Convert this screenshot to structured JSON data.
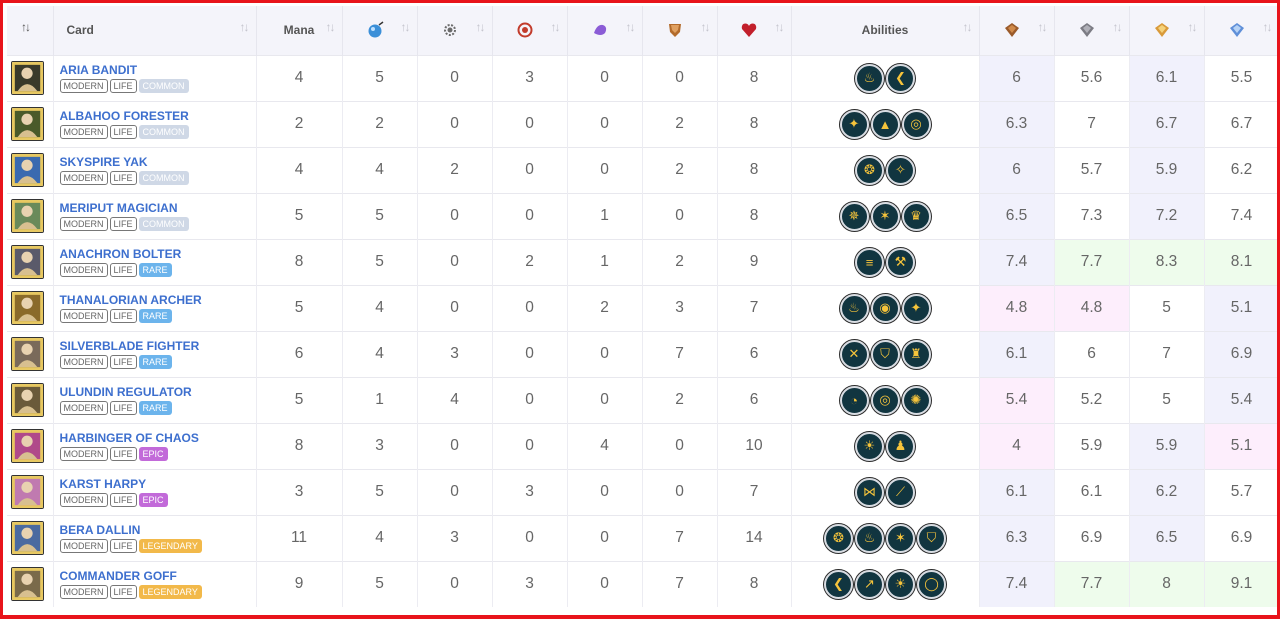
{
  "header": {
    "card_label": "Card",
    "mana_label": "Mana",
    "abilities_label": "Abilities",
    "sort_glyph": "↑↓",
    "stat_icons": [
      {
        "name": "ranged-attack-icon",
        "color": "#3b8fd8"
      },
      {
        "name": "magic-attack-icon",
        "color": "#6b6b6b"
      },
      {
        "name": "melee-attack-icon",
        "color": "#c23b2b"
      },
      {
        "name": "speed-icon",
        "color": "#8b5cd6"
      },
      {
        "name": "armor-icon",
        "color": "#b36b2b"
      },
      {
        "name": "health-icon",
        "color": "#c21f2b"
      }
    ],
    "level_icons": [
      {
        "name": "bronze-league-icon",
        "color": "#9a5a2a"
      },
      {
        "name": "silver-league-icon",
        "color": "#7c7c84"
      },
      {
        "name": "gold-league-icon",
        "color": "#d99a3a"
      },
      {
        "name": "diamond-league-icon",
        "color": "#5f8fd8"
      }
    ]
  },
  "colors": {
    "common": "#cfd8e6",
    "rare": "#6cb4ec",
    "epic": "#c26ad9",
    "legendary": "#f2b94a",
    "link": "#3d6fce",
    "frame": "#e8141b"
  },
  "rows": [
    {
      "name": "ARIA BANDIT",
      "edition": "MODERN",
      "element": "LIFE",
      "rarity": "COMMON",
      "rarity_key": "common",
      "thumb": "#3a3a2a",
      "mana": "4",
      "stats": [
        "5",
        "0",
        "3",
        "0",
        "0",
        "8"
      ],
      "abilities": [
        {
          "icon": "scavenger-icon",
          "glyph": "♨"
        },
        {
          "icon": "sneak-icon",
          "glyph": "❮"
        }
      ],
      "levels": [
        "6",
        "5.6",
        "6.1",
        "5.5"
      ],
      "level_bg": [
        "lav",
        "white",
        "lav",
        "white"
      ]
    },
    {
      "name": "ALBAHOO FORESTER",
      "edition": "MODERN",
      "element": "LIFE",
      "rarity": "COMMON",
      "rarity_key": "common",
      "thumb": "#4a5a2a",
      "mana": "2",
      "stats": [
        "2",
        "0",
        "0",
        "0",
        "2",
        "8"
      ],
      "abilities": [
        {
          "icon": "martyr-icon",
          "glyph": "✦"
        },
        {
          "icon": "divine-shield-icon",
          "glyph": "▲"
        },
        {
          "icon": "target-icon",
          "glyph": "◎"
        }
      ],
      "levels": [
        "6.3",
        "7",
        "6.7",
        "6.7"
      ],
      "level_bg": [
        "lav",
        "white",
        "lav",
        "white"
      ]
    },
    {
      "name": "SKYSPIRE YAK",
      "edition": "MODERN",
      "element": "LIFE",
      "rarity": "COMMON",
      "rarity_key": "common",
      "thumb": "#3a6ab0",
      "mana": "4",
      "stats": [
        "4",
        "2",
        "0",
        "0",
        "2",
        "8"
      ],
      "abilities": [
        {
          "icon": "retaliate-icon",
          "glyph": "❂"
        },
        {
          "icon": "blast-icon",
          "glyph": "✧"
        }
      ],
      "levels": [
        "6",
        "5.7",
        "5.9",
        "6.2"
      ],
      "level_bg": [
        "lav",
        "white",
        "lav",
        "white"
      ]
    },
    {
      "name": "MERIPUT MAGICIAN",
      "edition": "MODERN",
      "element": "LIFE",
      "rarity": "COMMON",
      "rarity_key": "common",
      "thumb": "#6a8a5a",
      "mana": "5",
      "stats": [
        "5",
        "0",
        "0",
        "1",
        "0",
        "8"
      ],
      "abilities": [
        {
          "icon": "flash-icon",
          "glyph": "✵"
        },
        {
          "icon": "strength-icon",
          "glyph": "✶"
        },
        {
          "icon": "crown-icon",
          "glyph": "♛"
        }
      ],
      "levels": [
        "6.5",
        "7.3",
        "7.2",
        "7.4"
      ],
      "level_bg": [
        "lav",
        "white",
        "lav",
        "white"
      ]
    },
    {
      "name": "ANACHRON BOLTER",
      "edition": "MODERN",
      "element": "LIFE",
      "rarity": "RARE",
      "rarity_key": "rare",
      "thumb": "#5a5a6a",
      "mana": "8",
      "stats": [
        "5",
        "0",
        "2",
        "1",
        "2",
        "9"
      ],
      "abilities": [
        {
          "icon": "swiftness-icon",
          "glyph": "≡"
        },
        {
          "icon": "hammer-icon",
          "glyph": "⚒"
        }
      ],
      "levels": [
        "7.4",
        "7.7",
        "8.3",
        "8.1"
      ],
      "level_bg": [
        "lav",
        "green",
        "green",
        "green"
      ]
    },
    {
      "name": "THANALORIAN ARCHER",
      "edition": "MODERN",
      "element": "LIFE",
      "rarity": "RARE",
      "rarity_key": "rare",
      "thumb": "#8a6a2a",
      "mana": "5",
      "stats": [
        "4",
        "0",
        "0",
        "2",
        "3",
        "7"
      ],
      "abilities": [
        {
          "icon": "scavenger-icon",
          "glyph": "♨"
        },
        {
          "icon": "eyes-icon",
          "glyph": "◉"
        },
        {
          "icon": "martyr-icon",
          "glyph": "✦"
        }
      ],
      "levels": [
        "4.8",
        "4.8",
        "5",
        "5.1"
      ],
      "level_bg": [
        "pink",
        "pink",
        "white",
        "lav"
      ]
    },
    {
      "name": "SILVERBLADE FIGHTER",
      "edition": "MODERN",
      "element": "LIFE",
      "rarity": "RARE",
      "rarity_key": "rare",
      "thumb": "#7a6a5a",
      "mana": "6",
      "stats": [
        "4",
        "3",
        "0",
        "0",
        "7",
        "6"
      ],
      "abilities": [
        {
          "icon": "bloodlust-icon",
          "glyph": "✕"
        },
        {
          "icon": "shield-icon",
          "glyph": "⛉"
        },
        {
          "icon": "castle-icon",
          "glyph": "♜"
        }
      ],
      "levels": [
        "6.1",
        "6",
        "7",
        "6.9"
      ],
      "level_bg": [
        "lav",
        "white",
        "white",
        "lav"
      ]
    },
    {
      "name": "ULUNDIN REGULATOR",
      "edition": "MODERN",
      "element": "LIFE",
      "rarity": "RARE",
      "rarity_key": "rare",
      "thumb": "#6a5a3a",
      "mana": "5",
      "stats": [
        "1",
        "4",
        "0",
        "0",
        "2",
        "6"
      ],
      "abilities": [
        {
          "icon": "eye-icon",
          "glyph": "◔"
        },
        {
          "icon": "target-icon",
          "glyph": "◎"
        },
        {
          "icon": "sparkle-icon",
          "glyph": "✺"
        }
      ],
      "levels": [
        "5.4",
        "5.2",
        "5",
        "5.4"
      ],
      "level_bg": [
        "pink",
        "white",
        "white",
        "lav"
      ]
    },
    {
      "name": "HARBINGER OF CHAOS",
      "edition": "MODERN",
      "element": "LIFE",
      "rarity": "EPIC",
      "rarity_key": "epic",
      "thumb": "#b04a8a",
      "mana": "8",
      "stats": [
        "3",
        "0",
        "0",
        "4",
        "0",
        "10"
      ],
      "abilities": [
        {
          "icon": "sun-icon",
          "glyph": "☀"
        },
        {
          "icon": "bust-icon",
          "glyph": "♟"
        }
      ],
      "levels": [
        "4",
        "5.9",
        "5.9",
        "5.1"
      ],
      "level_bg": [
        "pink",
        "white",
        "lav",
        "pink"
      ]
    },
    {
      "name": "KARST HARPY",
      "edition": "MODERN",
      "element": "LIFE",
      "rarity": "EPIC",
      "rarity_key": "epic",
      "thumb": "#c07ab0",
      "mana": "3",
      "stats": [
        "5",
        "0",
        "3",
        "0",
        "0",
        "7"
      ],
      "abilities": [
        {
          "icon": "wings-icon",
          "glyph": "⋈"
        },
        {
          "icon": "claw-icon",
          "glyph": "⟋"
        }
      ],
      "levels": [
        "6.1",
        "6.1",
        "6.2",
        "5.7"
      ],
      "level_bg": [
        "lav",
        "white",
        "lav",
        "white"
      ]
    },
    {
      "name": "BERA DALLIN",
      "edition": "MODERN",
      "element": "LIFE",
      "rarity": "LEGENDARY",
      "rarity_key": "legendary",
      "thumb": "#4a6aa0",
      "mana": "11",
      "stats": [
        "4",
        "3",
        "0",
        "0",
        "7",
        "14"
      ],
      "abilities": [
        {
          "icon": "retaliate-icon",
          "glyph": "❂"
        },
        {
          "icon": "scavenger-icon",
          "glyph": "♨"
        },
        {
          "icon": "strength-icon",
          "glyph": "✶"
        },
        {
          "icon": "shield-icon",
          "glyph": "⛉"
        }
      ],
      "levels": [
        "6.3",
        "6.9",
        "6.5",
        "6.9"
      ],
      "level_bg": [
        "lav",
        "white",
        "lav",
        "white"
      ]
    },
    {
      "name": "COMMANDER GOFF",
      "edition": "MODERN",
      "element": "LIFE",
      "rarity": "LEGENDARY",
      "rarity_key": "legendary",
      "thumb": "#7a6a4a",
      "mana": "9",
      "stats": [
        "5",
        "0",
        "3",
        "0",
        "7",
        "8"
      ],
      "abilities": [
        {
          "icon": "sneak-icon",
          "glyph": "❮"
        },
        {
          "icon": "spear-icon",
          "glyph": "↗"
        },
        {
          "icon": "sun-icon",
          "glyph": "☀"
        },
        {
          "icon": "ring-icon",
          "glyph": "◯"
        }
      ],
      "levels": [
        "7.4",
        "7.7",
        "8",
        "9.1"
      ],
      "level_bg": [
        "lav",
        "green",
        "green",
        "green"
      ]
    }
  ]
}
